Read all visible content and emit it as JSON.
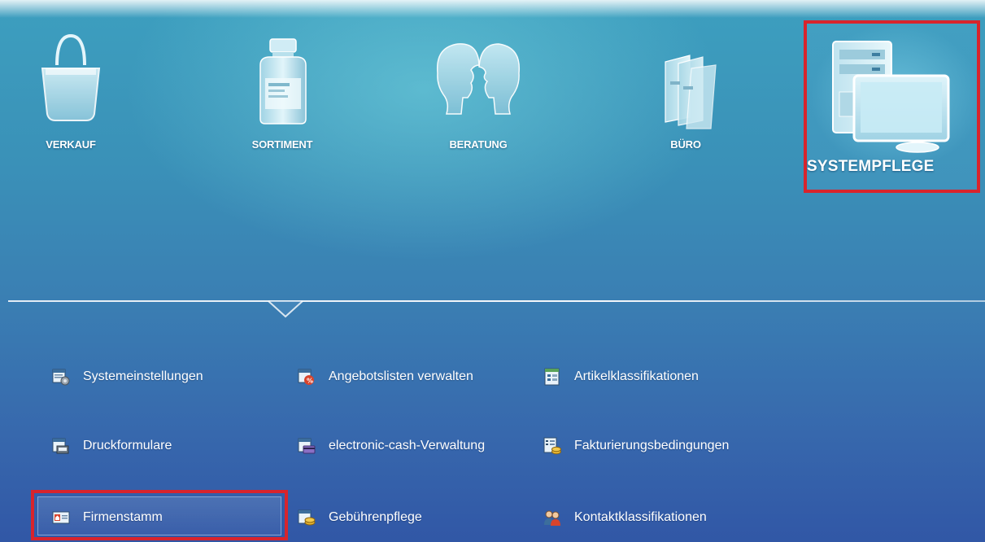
{
  "modules": {
    "verkauf": "VERKAUF",
    "sortiment": "SORTIMENT",
    "beratung": "BERATUNG",
    "buero": "BÜRO",
    "systempflege": "SYSTEMPFLEGE"
  },
  "menu": {
    "col1": [
      "Systemeinstellungen",
      "Druckformulare",
      "Firmenstamm"
    ],
    "col2": [
      "Angebotslisten verwalten",
      "electronic-cash-Verwaltung",
      "Gebührenpflege"
    ],
    "col3": [
      "Artikelklassifikationen",
      "Fakturierungsbedingungen",
      "Kontaktklassifikationen"
    ]
  },
  "colors": {
    "highlight_border": "#d8242c",
    "background_top": "#3d9fbf",
    "background_bottom": "#3157a6"
  }
}
